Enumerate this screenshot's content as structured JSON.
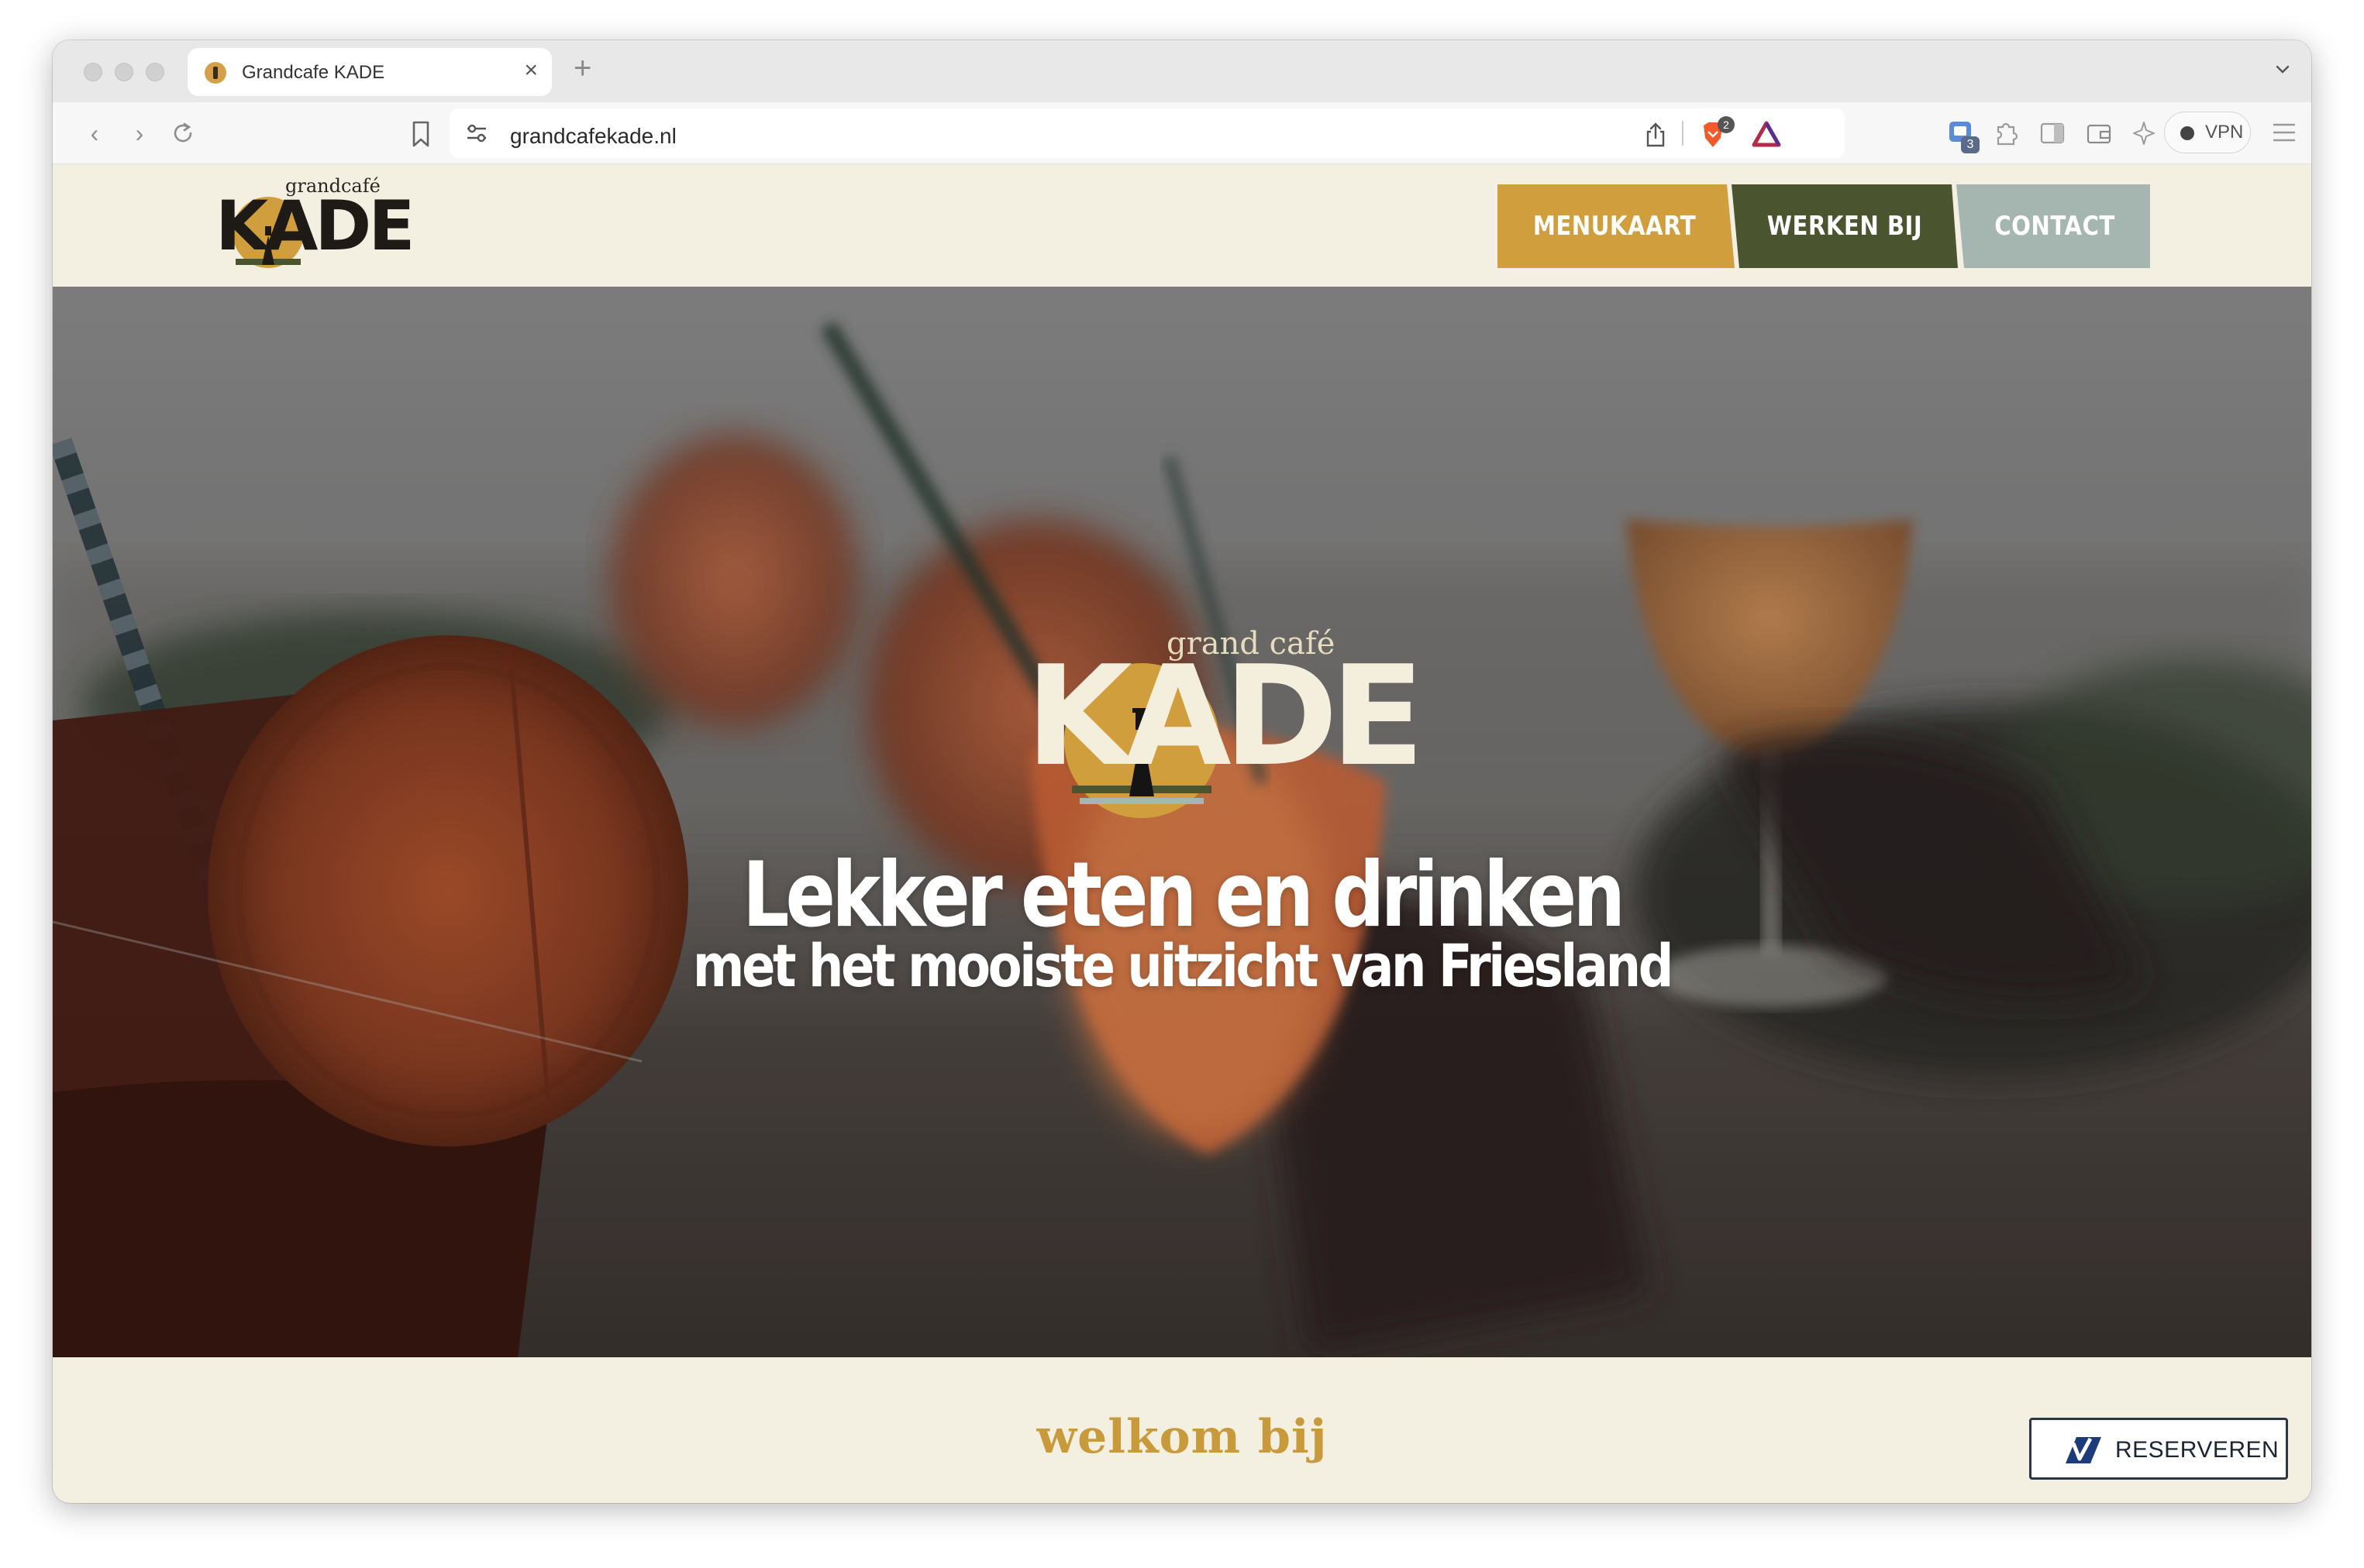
{
  "browser": {
    "tab_title": "Grandcafe KADE",
    "url": "grandcafekade.nl",
    "brave_shield_count": "2",
    "extension_badge": "3",
    "vpn_label": "VPN"
  },
  "site": {
    "logo_small": {
      "top_text": "grandcafé",
      "main_text": "KADE"
    },
    "nav": [
      {
        "label": "MENUKAART",
        "color": "#d19e3d"
      },
      {
        "label": "WERKEN BIJ",
        "color": "#4a5530"
      },
      {
        "label": "CONTACT",
        "color": "#a5b6b0"
      }
    ],
    "hero": {
      "logo_top_text": "grand café",
      "logo_main_text": "KADE",
      "headline": "Lekker eten en drinken",
      "subheadline": "met het mooiste uitzicht van Friesland"
    },
    "welcome_heading": "welkom bij",
    "reserve_button": "RESERVEREN"
  },
  "colors": {
    "page_bg": "#f3f0e2",
    "gold": "#c99a3c",
    "dark_green": "#4a5530",
    "sage": "#a5b6b0"
  }
}
